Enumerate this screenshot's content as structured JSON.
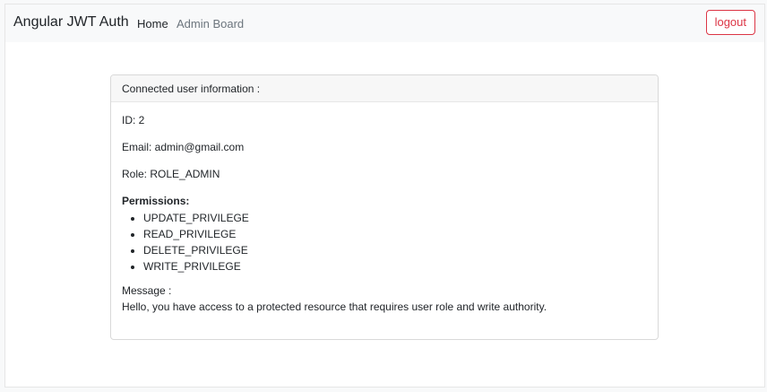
{
  "navbar": {
    "brand": "Angular JWT Auth",
    "links": {
      "home": "Home",
      "admin_board": "Admin Board"
    },
    "logout_label": "logout"
  },
  "card": {
    "header": "Connected user information :",
    "id_line": "ID: 2",
    "email_line": "Email: admin@gmail.com",
    "role_line": "Role: ROLE_ADMIN",
    "permissions_title": "Permissions:",
    "permissions": [
      "UPDATE_PRIVILEGE",
      "READ_PRIVILEGE",
      "DELETE_PRIVILEGE",
      "WRITE_PRIVILEGE"
    ],
    "message_label": "Message :",
    "message_text": "Hello, you have access to a protected resource that requires user role and write authority."
  },
  "colors": {
    "danger": "#dc3545",
    "navbar_bg": "#f8f9fa",
    "muted_link": "#6c757d"
  }
}
